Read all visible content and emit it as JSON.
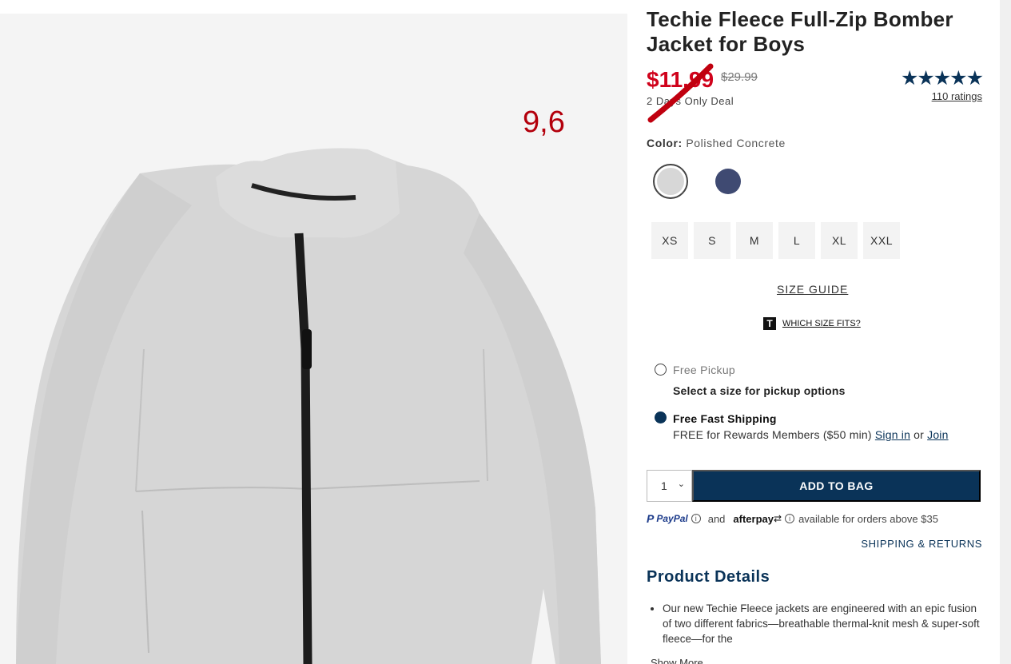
{
  "product": {
    "title": "Techie Fleece Full-Zip Bomber Jacket for Boys",
    "sale_price": "$11.99",
    "original_price": "$29.99",
    "deal_text": "2 Days Only Deal",
    "annotation": "9,6",
    "stars": "★★★★★",
    "ratings_link": "110 ratings"
  },
  "color": {
    "label": "Color:",
    "value": "Polished Concrete",
    "swatches": [
      {
        "name": "Polished Concrete",
        "hex": "#d7d7d7",
        "selected": true
      },
      {
        "name": "navy",
        "hex": "#3f4a72",
        "selected": false
      }
    ]
  },
  "sizes": [
    "XS",
    "S",
    "M",
    "L",
    "XL",
    "XXL"
  ],
  "size_guide": "SIZE GUIDE",
  "which_size": {
    "icon": "T",
    "label": "WHICH SIZE FITS?"
  },
  "fulfillment": {
    "pickup_label": "Free Pickup",
    "pickup_sub": "Select a size for pickup options",
    "shipping_label": "Free Fast Shipping",
    "shipping_sub": "FREE for Rewards Members ($50 min)",
    "sign_in": "Sign in",
    "or": "or",
    "join": "Join"
  },
  "purchase": {
    "quantity": "1",
    "add_to_bag": "ADD TO BAG"
  },
  "payments": {
    "paypal": "PayPal",
    "and": "and",
    "afterpay": "afterpay",
    "note": "available for orders above $35"
  },
  "shipping_returns": "SHIPPING & RETURNS",
  "details": {
    "title": "Product Details",
    "bullets": [
      "Our new Techie Fleece jackets are engineered with an epic fusion of two different fabrics—breathable thermal-knit mesh & super-soft fleece—for the"
    ],
    "show_more": "Show More"
  },
  "colors": {
    "brand_navy": "#0a3358",
    "sale_red": "#d0021b",
    "image_bg": "#f4f4f4",
    "jacket": "#d6d6d6"
  }
}
